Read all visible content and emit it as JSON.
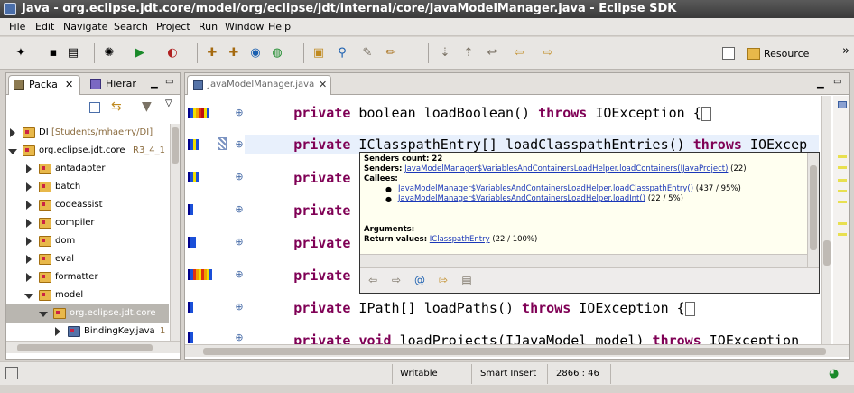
{
  "window": {
    "title": "Java - org.eclipse.jdt.core/model/org/eclipse/jdt/internal/core/JavaModelManager.java - Eclipse SDK"
  },
  "menu": [
    "File",
    "Edit",
    "Navigate",
    "Search",
    "Project",
    "Run",
    "Window",
    "Help"
  ],
  "toolbar": {
    "perspective_label": "Resource"
  },
  "left_panel": {
    "tabs": [
      "Packa",
      "Hierar"
    ],
    "tree": [
      {
        "label": "DI",
        "decoration": "[Students/mhaerry/DI]",
        "expanded": false,
        "indent": 0
      },
      {
        "label": "org.eclipse.jdt.core",
        "decoration": "R3_4_1",
        "expanded": true,
        "indent": 0
      },
      {
        "label": "antadapter",
        "decoration": "",
        "expanded": false,
        "indent": 1
      },
      {
        "label": "batch",
        "decoration": "",
        "expanded": false,
        "indent": 1
      },
      {
        "label": "codeassist",
        "decoration": "",
        "expanded": false,
        "indent": 1
      },
      {
        "label": "compiler",
        "decoration": "",
        "expanded": false,
        "indent": 1
      },
      {
        "label": "dom",
        "decoration": "",
        "expanded": false,
        "indent": 1
      },
      {
        "label": "eval",
        "decoration": "",
        "expanded": false,
        "indent": 1
      },
      {
        "label": "formatter",
        "decoration": "",
        "expanded": false,
        "indent": 1
      },
      {
        "label": "model",
        "decoration": "",
        "expanded": true,
        "indent": 1
      },
      {
        "label": "org.eclipse.jdt.core",
        "decoration": "",
        "expanded": true,
        "indent": 2,
        "selected": true
      },
      {
        "label": "BindingKey.java",
        "decoration": "1",
        "expanded": false,
        "indent": 3
      }
    ]
  },
  "editor": {
    "tab_label": "JavaModelManager.java",
    "lines": [
      {
        "kw1": "private",
        "rest1": " boolean ",
        "kw_type": "",
        "sig": "loadBoolean()",
        "kw2": " throws",
        "tail": " IOException {",
        "box": true
      },
      {
        "kw1": "private",
        "rest1": " IClasspathEntry[] ",
        "kw_type": "",
        "sig": "loadClasspathEntries()",
        "kw2": " throws",
        "tail": " IOExcep",
        "box": false
      },
      {
        "kw1": "private",
        "rest1": "",
        "kw_type": "",
        "sig": "",
        "kw2": "",
        "tail": "",
        "box": false
      },
      {
        "kw1": "private",
        "rest1": "",
        "kw_type": "",
        "sig": "",
        "kw2": "",
        "tail": "",
        "box": false
      },
      {
        "kw1": "private",
        "rest1": "",
        "kw_type": "",
        "sig": "",
        "kw2": "",
        "tail": "",
        "box": false
      },
      {
        "kw1": "private",
        "rest1": "",
        "kw_type": "",
        "sig": "",
        "kw2": "",
        "tail": "",
        "box": false
      },
      {
        "kw1": "private",
        "rest1": " IPath[] ",
        "kw_type": "",
        "sig": "loadPaths()",
        "kw2": " throws",
        "tail": " IOException {",
        "box": true
      },
      {
        "kw1": "private",
        "rest1": " ",
        "kw_type": "void",
        "sig": " loadProjects(IJavaModel model)",
        "kw2": " throws",
        "tail": " IOException",
        "box": false
      }
    ]
  },
  "popup": {
    "senders_count_label": "Senders count: 22",
    "senders_label": "Senders:",
    "senders_link": "JavaModelManager$VariablesAndContainersLoadHelper.loadContainers(IJavaProject)",
    "senders_count": "(22)",
    "callees_label": "Callees:",
    "callees": [
      {
        "link": "JavaModelManager$VariablesAndContainersLoadHelper.loadClasspathEntry()",
        "stat": "(437 / 95%)"
      },
      {
        "link": "JavaModelManager$VariablesAndContainersLoadHelper.loadInt()",
        "stat": "(22 / 5%)"
      }
    ],
    "arguments_label": "Arguments:",
    "return_label": "Return values:",
    "return_link": "IClasspathEntry",
    "return_stat": "(22 / 100%)"
  },
  "status": {
    "writable": "Writable",
    "insert_mode": "Smart Insert",
    "position": "2866 : 46"
  },
  "colors": {
    "keyword": "#7f0055",
    "link": "#1a37b8",
    "tooltip_bg": "#fffff0"
  }
}
